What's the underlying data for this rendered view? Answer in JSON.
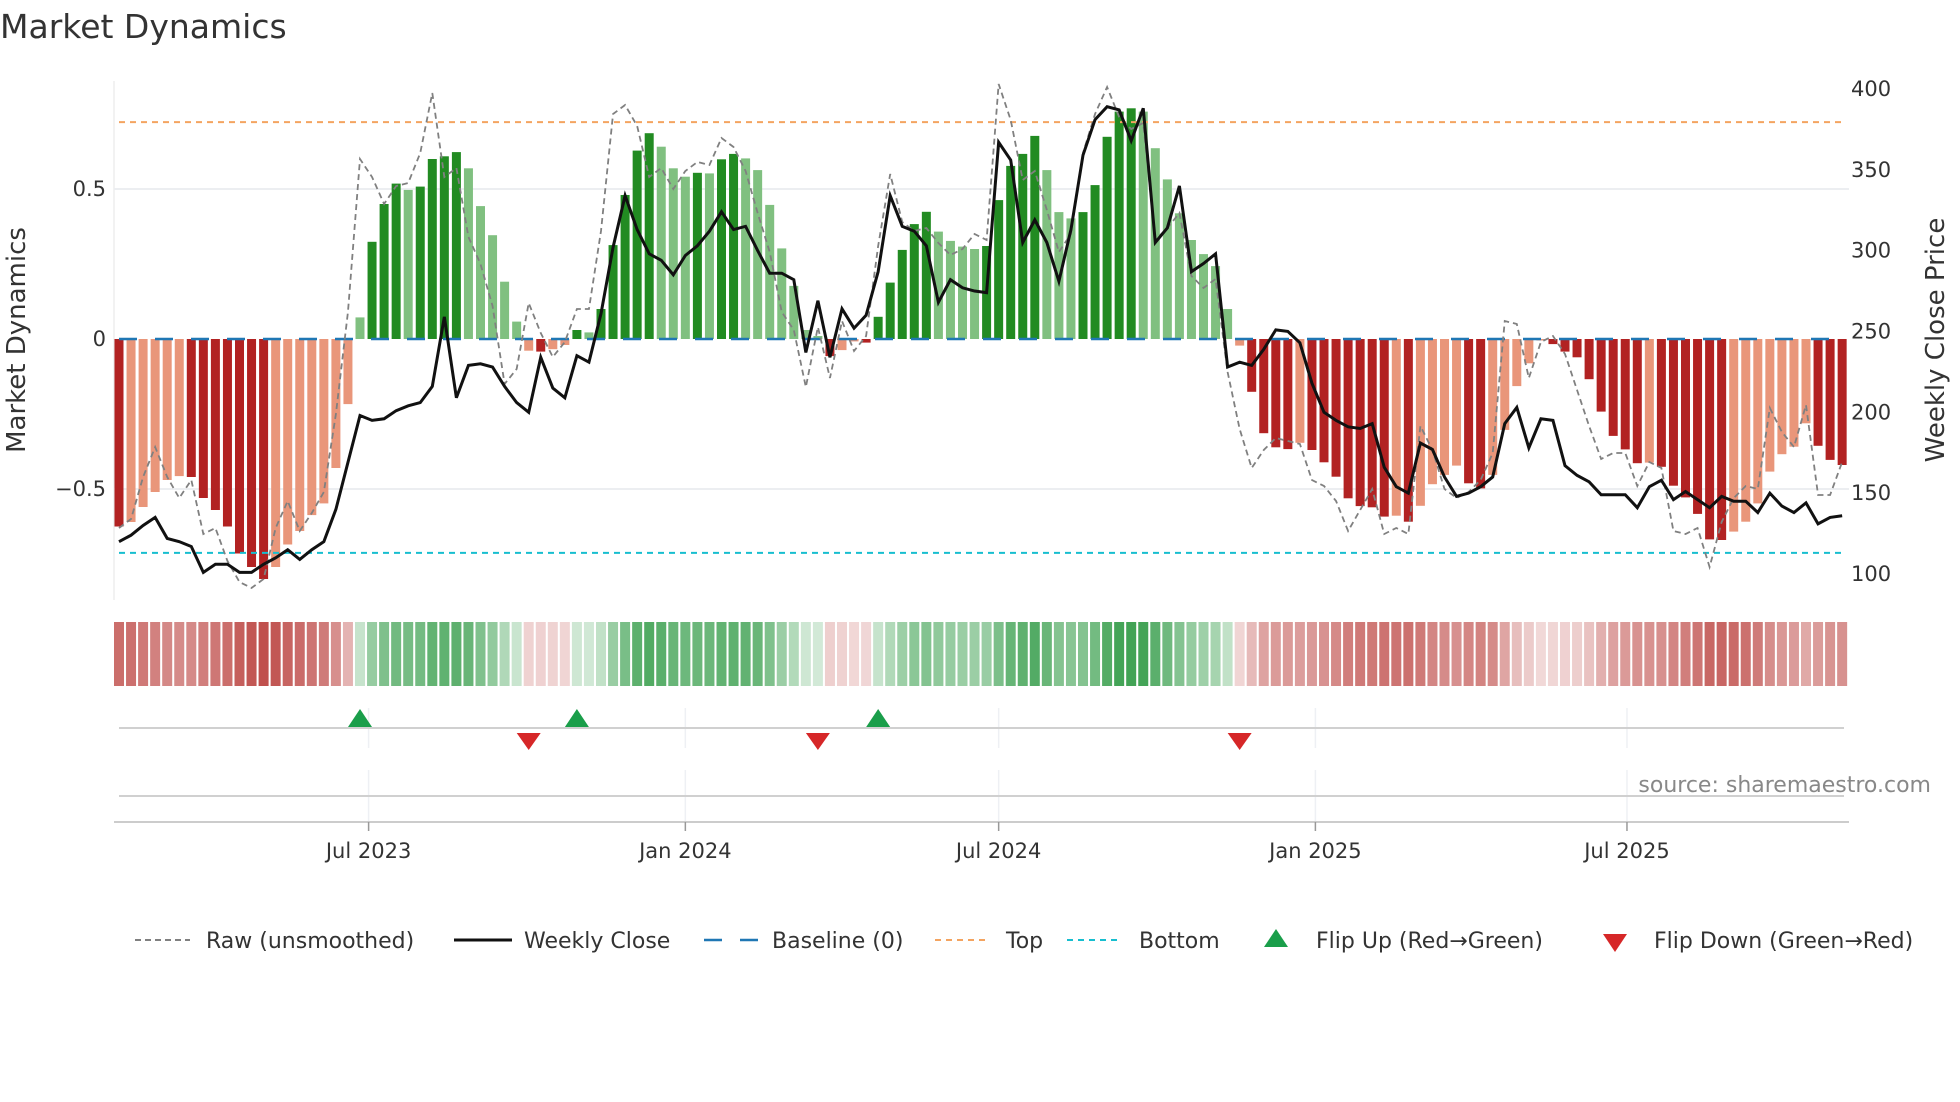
{
  "chart_data": {
    "type": "bar",
    "title": "Market Dynamics",
    "ylabel": "Market Dynamics",
    "y2label": "Weekly Close Price",
    "source": "source: sharemaestro.com",
    "x_start": "2023-02-06",
    "x_frequency": "weekly",
    "ylim": [
      -0.87,
      0.86
    ],
    "y2lim": [
      84,
      405
    ],
    "yticks": [
      {
        "value": 0.5,
        "label": "0.5"
      },
      {
        "value": 0,
        "label": "0"
      },
      {
        "value": -0.5,
        "label": "−0.5"
      }
    ],
    "y2ticks": [
      {
        "value": 400,
        "label": "400"
      },
      {
        "value": 350,
        "label": "350"
      },
      {
        "value": 300,
        "label": "300"
      },
      {
        "value": 250,
        "label": "250"
      },
      {
        "value": 200,
        "label": "200"
      },
      {
        "value": 150,
        "label": "150"
      },
      {
        "value": 100,
        "label": "100"
      }
    ],
    "xticks": [
      {
        "date": "2023-07-01",
        "label": "Jul 2023"
      },
      {
        "date": "2024-01-01",
        "label": "Jan 2024"
      },
      {
        "date": "2024-07-01",
        "label": "Jul 2024"
      },
      {
        "date": "2025-01-01",
        "label": "Jan 2025"
      },
      {
        "date": "2025-07-01",
        "label": "Jul 2025"
      }
    ],
    "grid": true,
    "top_level": 0.723,
    "bottom_level": -0.713,
    "baseline": 0,
    "colors": {
      "green_strong": "#228b22",
      "green_weak": "#80c080",
      "red_strong": "#b22222",
      "red_weak": "#e9967a",
      "raw": "#808080",
      "close": "#111111",
      "baseline": "#1f77b4",
      "top": "#f4a460",
      "bottom": "#17becf",
      "flip_up": "#1a9e4a",
      "flip_down": "#d62728",
      "heat_green": "#3ca050",
      "heat_red": "#c0504d"
    },
    "series": [
      {
        "name": "Market Dynamics",
        "kind": "bar",
        "values": [
          -0.625,
          -0.61,
          -0.56,
          -0.51,
          -0.47,
          -0.457,
          -0.46,
          -0.53,
          -0.57,
          -0.625,
          -0.715,
          -0.76,
          -0.8,
          -0.76,
          -0.685,
          -0.64,
          -0.587,
          -0.548,
          -0.43,
          -0.217,
          0.072,
          0.324,
          0.45,
          0.518,
          0.497,
          0.508,
          0.6,
          0.609,
          0.623,
          0.569,
          0.443,
          0.346,
          0.191,
          0.058,
          -0.039,
          -0.042,
          -0.034,
          -0.02,
          0.03,
          0.022,
          0.1,
          0.313,
          0.48,
          0.628,
          0.686,
          0.641,
          0.569,
          0.541,
          0.554,
          0.552,
          0.599,
          0.617,
          0.602,
          0.563,
          0.447,
          0.302,
          0.177,
          0.03,
          0.01,
          -0.057,
          -0.037,
          -0.008,
          -0.012,
          0.074,
          0.188,
          0.297,
          0.383,
          0.424,
          0.358,
          0.327,
          0.308,
          0.3,
          0.31,
          0.463,
          0.577,
          0.617,
          0.677,
          0.563,
          0.423,
          0.402,
          0.423,
          0.513,
          0.674,
          0.758,
          0.769,
          0.758,
          0.636,
          0.532,
          0.419,
          0.33,
          0.283,
          0.243,
          0.1,
          -0.022,
          -0.176,
          -0.314,
          -0.361,
          -0.367,
          -0.346,
          -0.37,
          -0.411,
          -0.459,
          -0.531,
          -0.557,
          -0.561,
          -0.592,
          -0.589,
          -0.609,
          -0.556,
          -0.484,
          -0.453,
          -0.422,
          -0.481,
          -0.498,
          -0.453,
          -0.303,
          -0.157,
          -0.081,
          -0.005,
          -0.017,
          -0.042,
          -0.061,
          -0.134,
          -0.242,
          -0.323,
          -0.368,
          -0.414,
          -0.412,
          -0.426,
          -0.489,
          -0.528,
          -0.583,
          -0.668,
          -0.67,
          -0.642,
          -0.609,
          -0.548,
          -0.442,
          -0.384,
          -0.359,
          -0.281,
          -0.356,
          -0.403,
          -0.42
        ]
      },
      {
        "name": "Raw (unsmoothed)",
        "kind": "line",
        "values": [
          -0.63,
          -0.6,
          -0.46,
          -0.36,
          -0.46,
          -0.53,
          -0.47,
          -0.65,
          -0.63,
          -0.74,
          -0.81,
          -0.83,
          -0.8,
          -0.63,
          -0.54,
          -0.64,
          -0.58,
          -0.51,
          -0.25,
          0.09,
          0.6,
          0.54,
          0.45,
          0.51,
          0.52,
          0.62,
          0.82,
          0.54,
          0.57,
          0.34,
          0.25,
          0.11,
          -0.15,
          -0.1,
          0.12,
          0.02,
          -0.06,
          -0.01,
          0.1,
          0.1,
          0.36,
          0.75,
          0.78,
          0.71,
          0.54,
          0.57,
          0.5,
          0.56,
          0.59,
          0.58,
          0.67,
          0.64,
          0.56,
          0.42,
          0.29,
          0.09,
          0.03,
          -0.16,
          0.04,
          -0.13,
          0.06,
          -0.04,
          0.01,
          0.31,
          0.55,
          0.39,
          0.36,
          0.37,
          0.32,
          0.28,
          0.3,
          0.35,
          0.33,
          0.85,
          0.73,
          0.53,
          0.56,
          0.43,
          0.29,
          0.35,
          0.62,
          0.75,
          0.84,
          0.74,
          0.7,
          0.72,
          0.33,
          0.37,
          0.42,
          0.21,
          0.17,
          0.2,
          -0.11,
          -0.3,
          -0.43,
          -0.37,
          -0.33,
          -0.34,
          -0.35,
          -0.47,
          -0.49,
          -0.54,
          -0.64,
          -0.57,
          -0.5,
          -0.65,
          -0.63,
          -0.65,
          -0.29,
          -0.37,
          -0.5,
          -0.53,
          -0.51,
          -0.47,
          -0.38,
          0.06,
          0.05,
          -0.13,
          -0.01,
          0.01,
          -0.05,
          -0.17,
          -0.29,
          -0.4,
          -0.38,
          -0.38,
          -0.49,
          -0.41,
          -0.43,
          -0.64,
          -0.65,
          -0.63,
          -0.76,
          -0.61,
          -0.53,
          -0.49,
          -0.5,
          -0.23,
          -0.31,
          -0.36,
          -0.22,
          -0.52,
          -0.52,
          -0.41
        ]
      },
      {
        "name": "Weekly Close",
        "kind": "line",
        "axis": "right",
        "values": [
          120,
          124,
          130,
          135,
          122,
          120,
          117,
          101,
          106,
          106,
          101,
          101,
          106,
          110,
          115,
          109,
          115,
          120,
          140,
          169,
          198,
          195,
          196,
          201,
          204,
          206,
          216,
          259,
          209,
          229,
          230,
          228,
          216,
          206,
          200,
          234,
          215,
          209,
          235,
          231,
          261,
          302,
          334,
          313,
          298,
          294,
          285,
          297,
          303,
          312,
          324,
          313,
          315,
          300,
          286,
          286,
          282,
          237,
          269,
          234,
          264,
          252,
          260,
          287,
          334,
          315,
          312,
          303,
          268,
          282,
          277,
          275,
          274,
          367,
          356,
          305,
          319,
          305,
          281,
          313,
          359,
          381,
          389,
          387,
          368,
          388,
          305,
          314,
          340,
          287,
          292,
          298,
          228,
          231,
          229,
          239,
          251,
          250,
          243,
          218,
          200,
          195,
          191,
          190,
          193,
          166,
          154,
          150,
          181,
          177,
          160,
          148,
          150,
          154,
          160,
          193,
          203,
          178,
          196,
          195,
          167,
          161,
          157,
          149,
          149,
          149,
          141,
          154,
          158,
          146,
          151,
          146,
          141,
          148,
          145,
          145,
          138,
          150,
          142,
          138,
          144,
          131,
          135,
          136
        ]
      }
    ],
    "flips": {
      "up": [
        21,
        39,
        64
      ],
      "down": [
        35,
        59,
        94
      ]
    },
    "legend": {
      "position": "bottom",
      "items": [
        {
          "label": "Raw (unsmoothed)",
          "style": "dashed-gray"
        },
        {
          "label": "Weekly Close",
          "style": "solid-black"
        },
        {
          "label": "Baseline (0)",
          "style": "dashed-blue"
        },
        {
          "label": "Top",
          "style": "dotted-orange"
        },
        {
          "label": "Bottom",
          "style": "dotted-cyan"
        },
        {
          "label": "Flip Up (Red→Green)",
          "style": "triangle-up-green"
        },
        {
          "label": "Flip Down (Green→Red)",
          "style": "triangle-down-red"
        }
      ]
    }
  }
}
